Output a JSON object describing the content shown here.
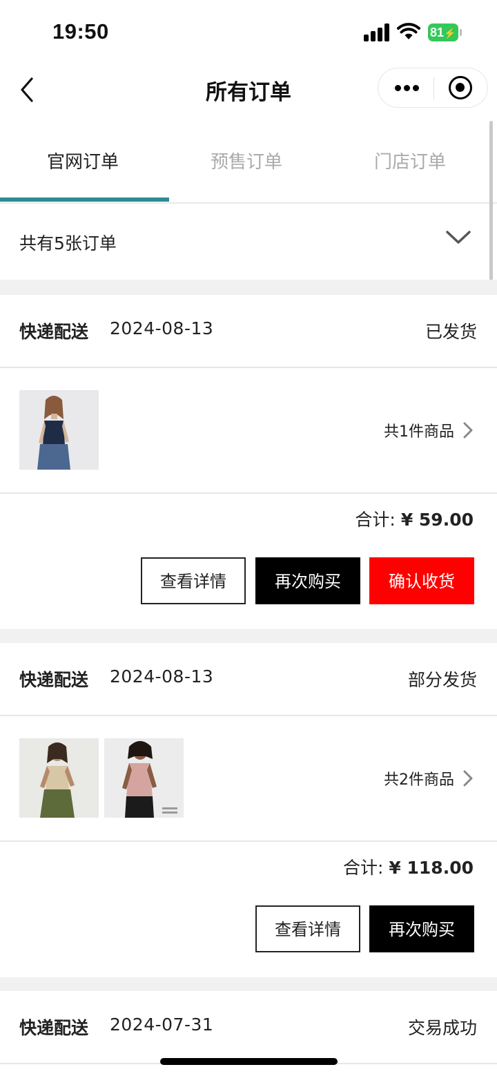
{
  "status_bar": {
    "time": "19:50",
    "battery": "81"
  },
  "nav": {
    "title": "所有订单"
  },
  "tabs": [
    {
      "label": "官网订单",
      "active": true
    },
    {
      "label": "预售订单",
      "active": false
    },
    {
      "label": "门店订单",
      "active": false
    }
  ],
  "summary": {
    "text": "共有5张订单"
  },
  "orders": [
    {
      "delivery": "快递配送",
      "date": "2024-08-13",
      "status": "已发货",
      "item_count": "共1件商品",
      "total_label": "合计:",
      "total_value": "¥ 59.00",
      "buttons": {
        "details": "查看详情",
        "rebuy": "再次购买",
        "confirm": "确认收货"
      }
    },
    {
      "delivery": "快递配送",
      "date": "2024-08-13",
      "status": "部分发货",
      "item_count": "共2件商品",
      "total_label": "合计:",
      "total_value": "¥ 118.00",
      "buttons": {
        "details": "查看详情",
        "rebuy": "再次购买"
      }
    },
    {
      "delivery": "快递配送",
      "date": "2024-07-31",
      "status": "交易成功"
    }
  ],
  "colors": {
    "tab_indicator": "#2e8b93",
    "confirm_button": "#ff0000",
    "battery": "#34c759"
  }
}
